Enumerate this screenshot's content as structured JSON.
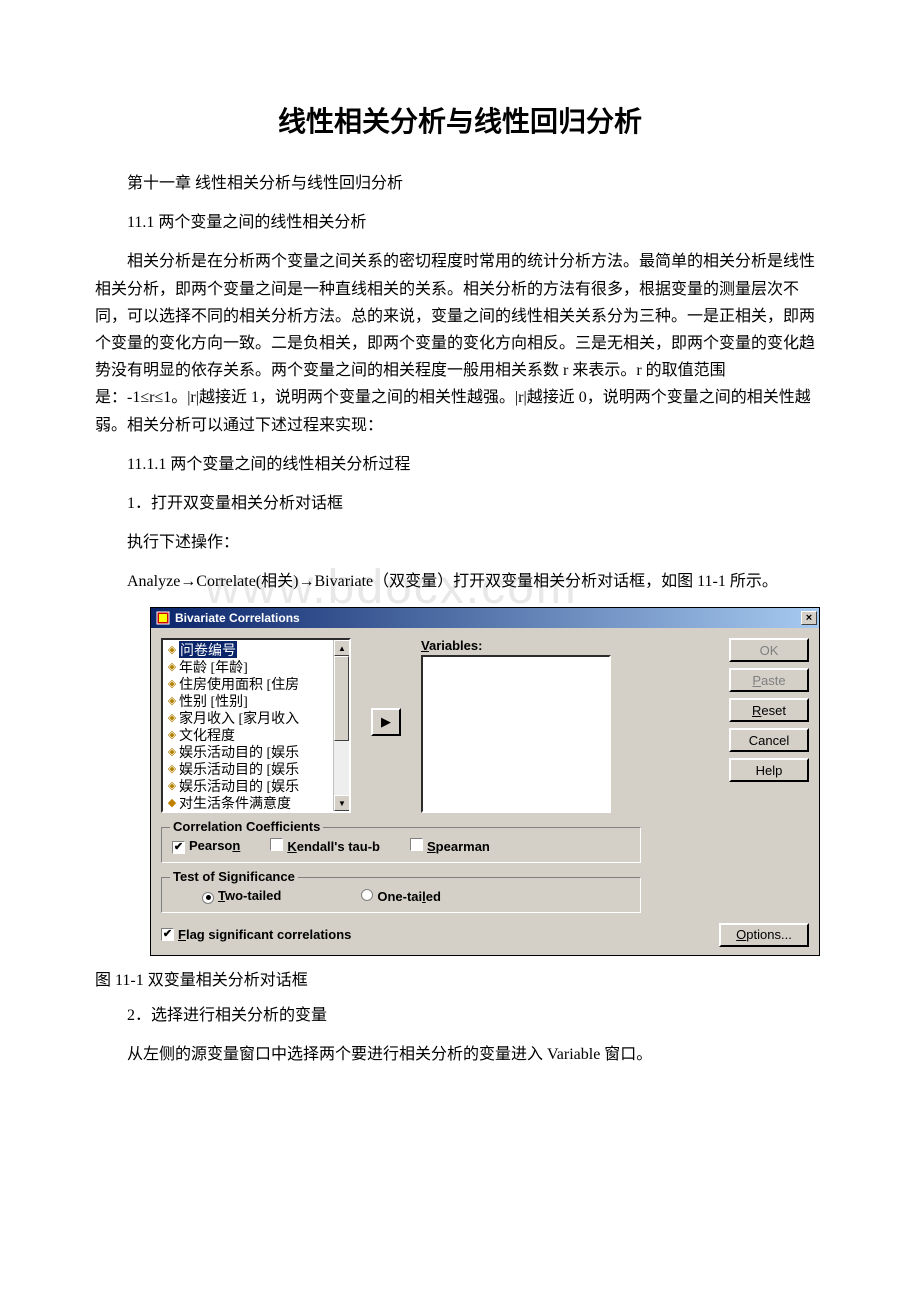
{
  "title": "线性相关分析与线性回归分析",
  "p1": "第十一章 线性相关分析与线性回归分析",
  "p2": "11.1 两个变量之间的线性相关分析",
  "p3": "相关分析是在分析两个变量之间关系的密切程度时常用的统计分析方法。最简单的相关分析是线性相关分析，即两个变量之间是一种直线相关的关系。相关分析的方法有很多，根据变量的测量层次不同，可以选择不同的相关分析方法。总的来说，变量之间的线性相关关系分为三种。一是正相关，即两个变量的变化方向一致。二是负相关，即两个变量的变化方向相反。三是无相关，即两个变量的变化趋势没有明显的依存关系。两个变量之间的相关程度一般用相关系数 r 来表示。r 的取值范围是：-1≤r≤1。|r|越接近 1，说明两个变量之间的相关性越强。|r|越接近 0，说明两个变量之间的相关性越弱。相关分析可以通过下述过程来实现：",
  "p4": "11.1.1 两个变量之间的线性相关分析过程",
  "p5": "1．打开双变量相关分析对话框",
  "p6": "执行下述操作：",
  "p7": "Analyze→Correlate(相关)→Bivariate（双变量）打开双变量相关分析对话框，如图 11-1 所示。",
  "watermark": "www.bdocx.com",
  "dialog": {
    "title": "Bivariate Correlations",
    "close": "×",
    "sourceItems": [
      "问卷编号",
      "年龄 [年龄]",
      "住房使用面积 [住房",
      "性别 [性别]",
      "家月收入 [家月收入",
      "文化程度",
      "娱乐活动目的 [娱乐",
      "娱乐活动目的 [娱乐",
      "娱乐活动目的 [娱乐",
      "对生活条件满意度"
    ],
    "varLabelPrefix": "V",
    "varLabelSuffix": "ariables:",
    "buttons": {
      "ok": "OK",
      "paste_u": "P",
      "paste_r": "aste",
      "reset_u": "R",
      "reset_r": "eset",
      "cancel": "Cancel",
      "help": "Help",
      "options_u": "O",
      "options_r": "ptions..."
    },
    "groups": {
      "corr": "Correlation Coefficients",
      "pearson_pre": "Pearso",
      "pearson_u": "n",
      "kendall_u": "K",
      "kendall_r": "endall's tau-b",
      "spearman_u": "S",
      "spearman_r": "pearman",
      "sig": "Test of Significance",
      "two_u": "T",
      "two_r": "wo-tailed",
      "one_pre": "One-tai",
      "one_u": "l",
      "one_suf": "ed"
    },
    "flag_u": "F",
    "flag_r": "lag significant correlations"
  },
  "caption": "图 11-1 双变量相关分析对话框",
  "p8": "2．选择进行相关分析的变量",
  "p9": "从左侧的源变量窗口中选择两个要进行相关分析的变量进入 Variable 窗口。"
}
